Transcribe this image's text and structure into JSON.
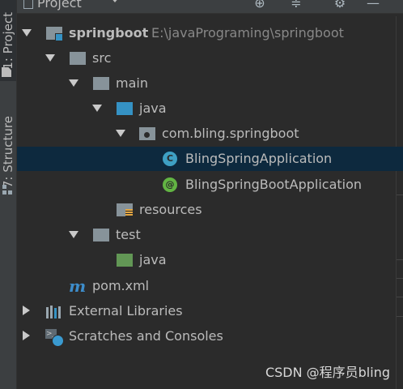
{
  "side_tabs": {
    "project": "1: Project",
    "structure": "7: Structure"
  },
  "header": {
    "title": "Project",
    "icons": [
      "locate-icon",
      "collapse-all-icon",
      "settings-gear-icon",
      "hide-icon"
    ]
  },
  "tree": [
    {
      "label": "springboot",
      "secondary": "E:\\javaPrograming\\springboot",
      "icon": "module-folder",
      "state": "expanded"
    },
    {
      "label": "src",
      "icon": "folder-gray",
      "state": "expanded"
    },
    {
      "label": "main",
      "icon": "folder-gray",
      "state": "expanded"
    },
    {
      "label": "java",
      "icon": "folder-blue",
      "state": "expanded"
    },
    {
      "label": "com.bling.springboot",
      "icon": "package",
      "state": "expanded"
    },
    {
      "label": "BlingSpringApplication",
      "icon": "class-c",
      "selected": true
    },
    {
      "label": "BlingSpringBootApplication",
      "icon": "class-annotation"
    },
    {
      "label": "resources",
      "icon": "resources-folder"
    },
    {
      "label": "test",
      "icon": "folder-gray",
      "state": "expanded"
    },
    {
      "label": "java",
      "icon": "folder-green"
    },
    {
      "label": "pom.xml",
      "icon": "maven"
    },
    {
      "label": "External Libraries",
      "icon": "libraries",
      "state": "collapsed"
    },
    {
      "label": "Scratches and Consoles",
      "icon": "scratches",
      "state": "collapsed"
    }
  ],
  "icons": {
    "class_c_letter": "C",
    "class_at_letter": "@",
    "maven_letter": "m",
    "terminal_glyph": ">_"
  },
  "watermark": "CSDN @程序员bling",
  "colors": {
    "background": "#2b2b2b",
    "selection": "#0d293e",
    "source_folder": "#3592c4",
    "test_folder": "#629755"
  }
}
